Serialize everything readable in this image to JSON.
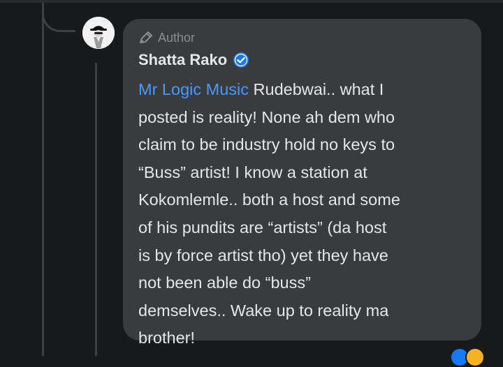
{
  "comment": {
    "badge_label": "Author",
    "author_name": "Shatta Rako",
    "mention": "Mr Logic Music",
    "text_lines": [
      " Rudebwai.. what I",
      "posted is reality! None ah dem who",
      "claim to be industry hold no keys to",
      "“Buss” artist! I know a station at",
      "Kokomlemle.. both a host and some",
      "of his pundits are “artists” (da host",
      "is by force artist tho) yet they have",
      "not been able do “buss”",
      "demselves.. Wake up to reality ma",
      "brother!"
    ]
  },
  "icons": {
    "badge": "pencil-icon",
    "verified": "verified-check-icon",
    "avatar": "profile-avatar"
  },
  "colors": {
    "background": "#18191a",
    "bubble": "#3a3b3c",
    "mention": "#4599ff",
    "text": "#e4e6eb",
    "muted": "#8a8d91",
    "verified": "#1877f2"
  }
}
